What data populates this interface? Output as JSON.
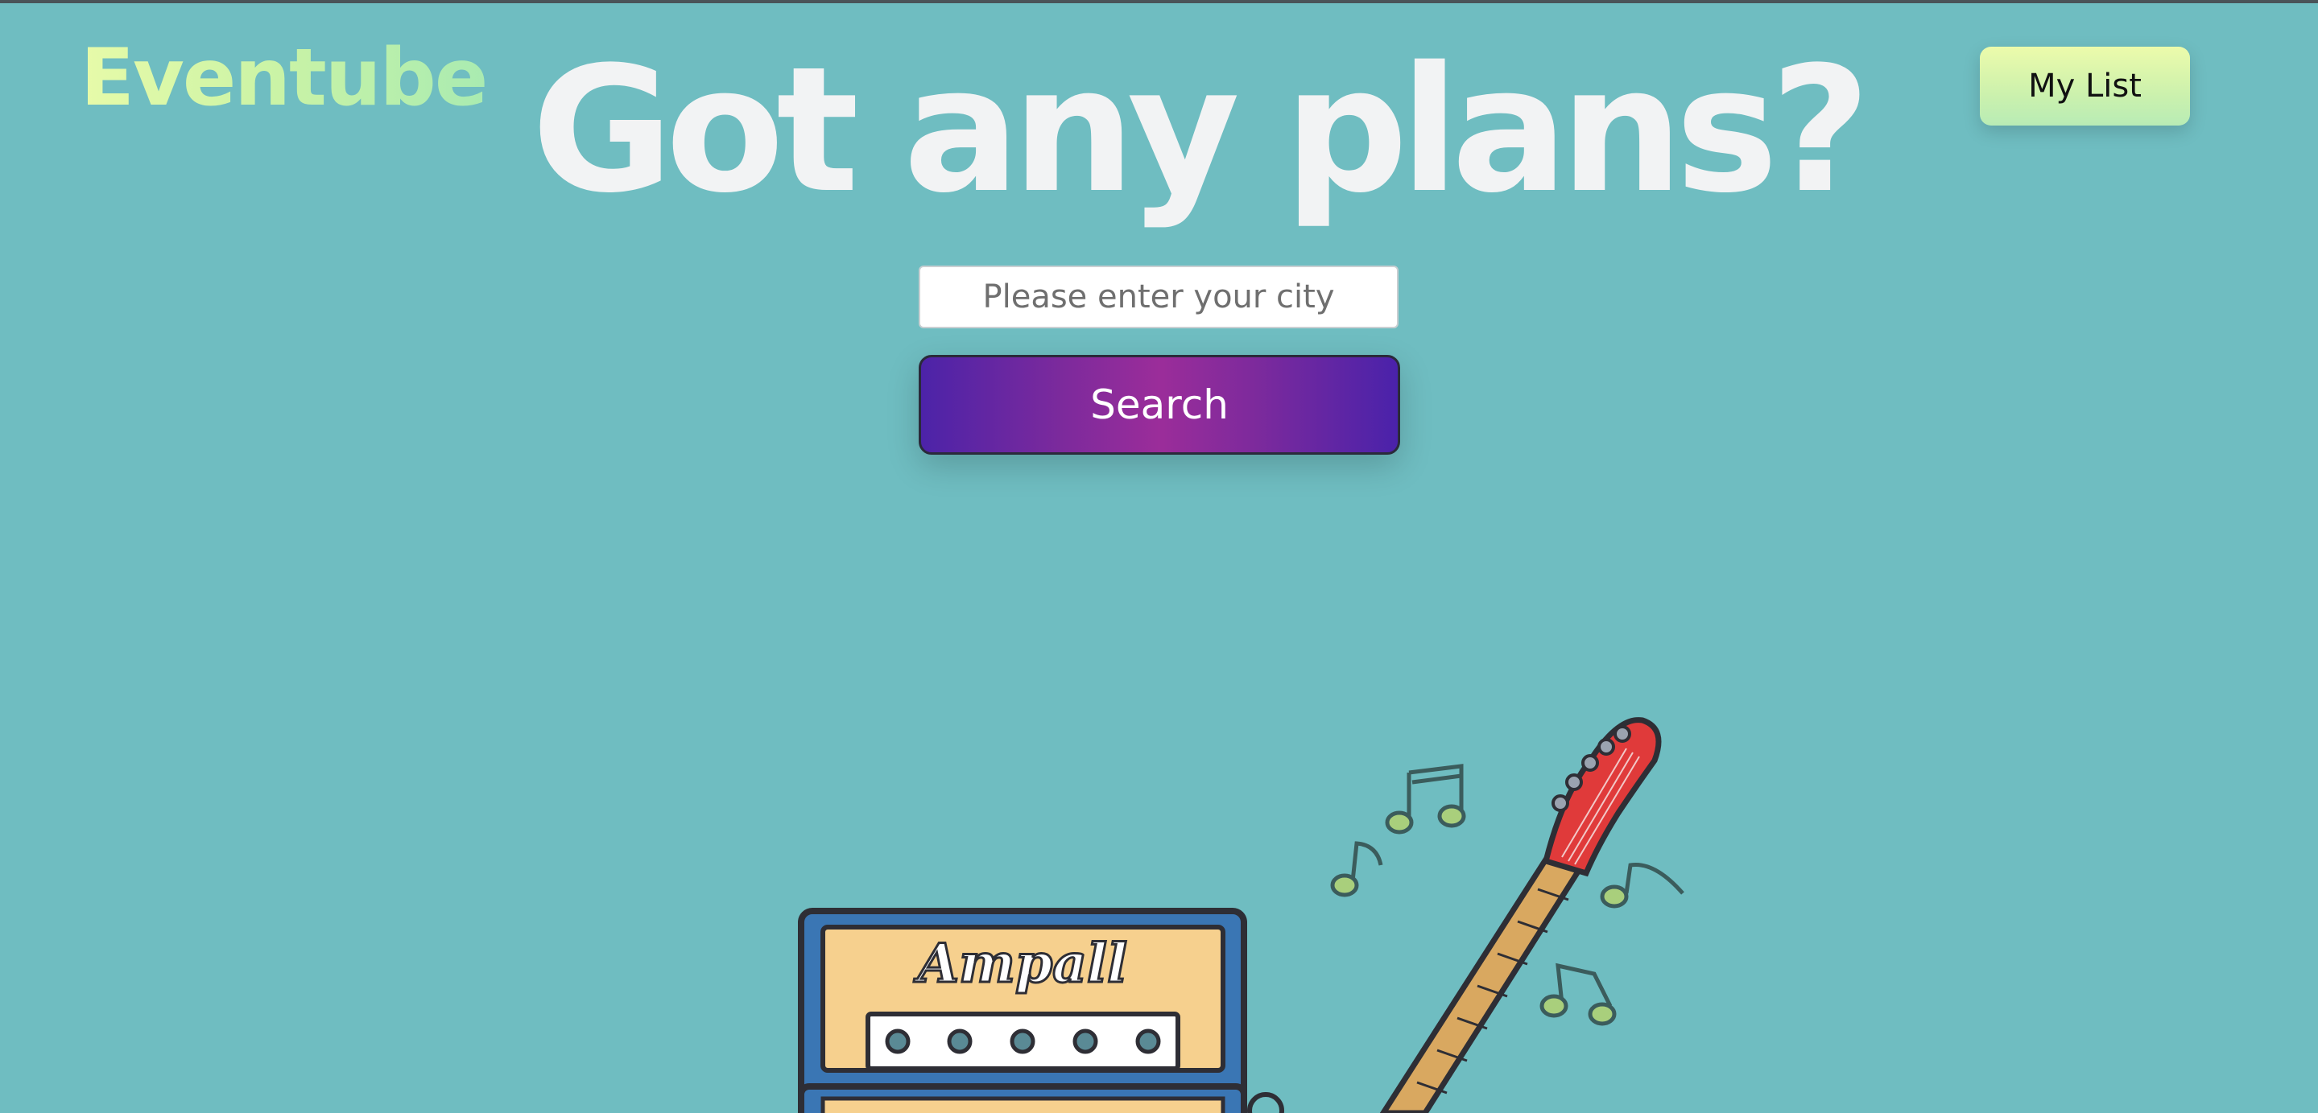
{
  "header": {
    "logo": "Eventube",
    "headline": "Got any plans?",
    "my_list_label": "My List"
  },
  "search": {
    "placeholder": "Please enter your city",
    "value": "",
    "button_label": "Search"
  },
  "illustration": {
    "amp_brand": "Ampall",
    "icons": [
      "amplifier-icon",
      "electric-guitar-icon",
      "music-note-icon"
    ]
  },
  "colors": {
    "background": "#6fbdc1",
    "logo_gradient_start": "#e7fba9",
    "logo_gradient_end": "#a9ebb1",
    "headline": "#f2f3f4",
    "search_button_start": "#4c23a8",
    "search_button_mid": "#9b2d9a",
    "guitar_head": "#e03a3a",
    "amp_face": "#f6d08e",
    "amp_frame": "#3a76b4",
    "note": "#a9cf7c"
  }
}
